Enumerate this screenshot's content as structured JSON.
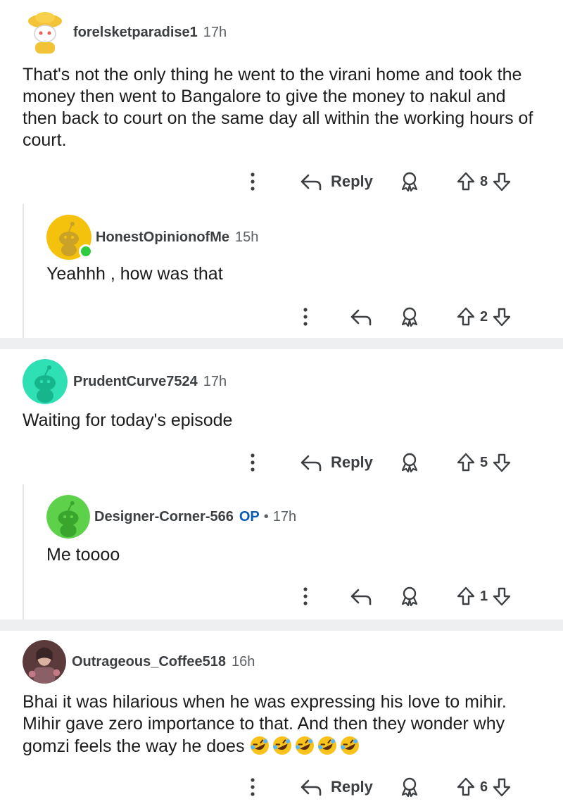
{
  "colors": {
    "accent_op": "#0a5cb8",
    "separator": "#edeff1",
    "online": "#2ecc40"
  },
  "comments": [
    {
      "username": "forelsketparadise1",
      "time": "17h",
      "avatar": "yellow-hat-snoo-avatar",
      "text": "That's not the only thing he went to the virani home and took the money then went to Bangalore to give the money to nakul and then back to court on the same day all within the working hours of court.",
      "reply_label": "Reply",
      "votes": "8",
      "replies": [
        {
          "username": "HonestOpinionofMe",
          "time": "15h",
          "avatar": "yellow-snoo-avatar",
          "online": true,
          "text": "Yeahhh , how was that",
          "votes": "2"
        }
      ]
    },
    {
      "username": "PrudentCurve7524",
      "time": "17h",
      "avatar": "teal-snoo-avatar",
      "text": "Waiting for today's episode",
      "reply_label": "Reply",
      "votes": "5",
      "replies": [
        {
          "username": "Designer-Corner-566",
          "op_badge": "OP",
          "separator": "•",
          "time": "17h",
          "avatar": "green-snoo-avatar",
          "text": "Me toooo",
          "votes": "1"
        }
      ]
    },
    {
      "username": "Outrageous_Coffee518",
      "time": "16h",
      "avatar": "photo-avatar",
      "text": "Bhai it was hilarious when he was expressing his love to mihir. Mihir gave zero importance to that. And then they wonder why gomzi feels the way he does",
      "emoji": "rolling-on-floor-laughing-emoji x5",
      "reply_label": "Reply",
      "votes": "6"
    }
  ]
}
